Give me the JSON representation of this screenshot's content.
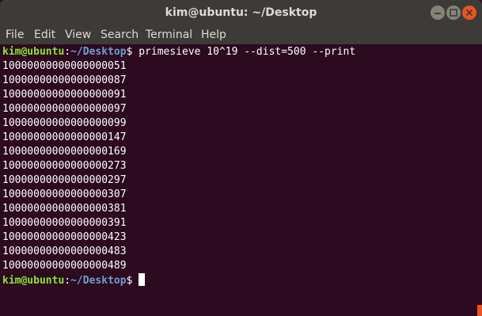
{
  "window": {
    "title": "kim@ubuntu: ~/Desktop"
  },
  "menu": [
    "File",
    "Edit",
    "View",
    "Search",
    "Terminal",
    "Help"
  ],
  "prompt": {
    "user": "kim@ubuntu",
    "sep": ":",
    "path": "~/Desktop",
    "dollar": "$"
  },
  "command": " primesieve 10^19 --dist=500 --print",
  "output": [
    "10000000000000000051",
    "10000000000000000087",
    "10000000000000000091",
    "10000000000000000097",
    "10000000000000000099",
    "10000000000000000147",
    "10000000000000000169",
    "10000000000000000273",
    "10000000000000000297",
    "10000000000000000307",
    "10000000000000000381",
    "10000000000000000391",
    "10000000000000000423",
    "10000000000000000483",
    "10000000000000000489"
  ],
  "colors": {
    "background": "#2c0a20",
    "user": "#8ae234",
    "path": "#729fcf",
    "accent": "#e95420"
  },
  "icons": [
    "minimize-icon",
    "maximize-icon",
    "close-icon"
  ]
}
